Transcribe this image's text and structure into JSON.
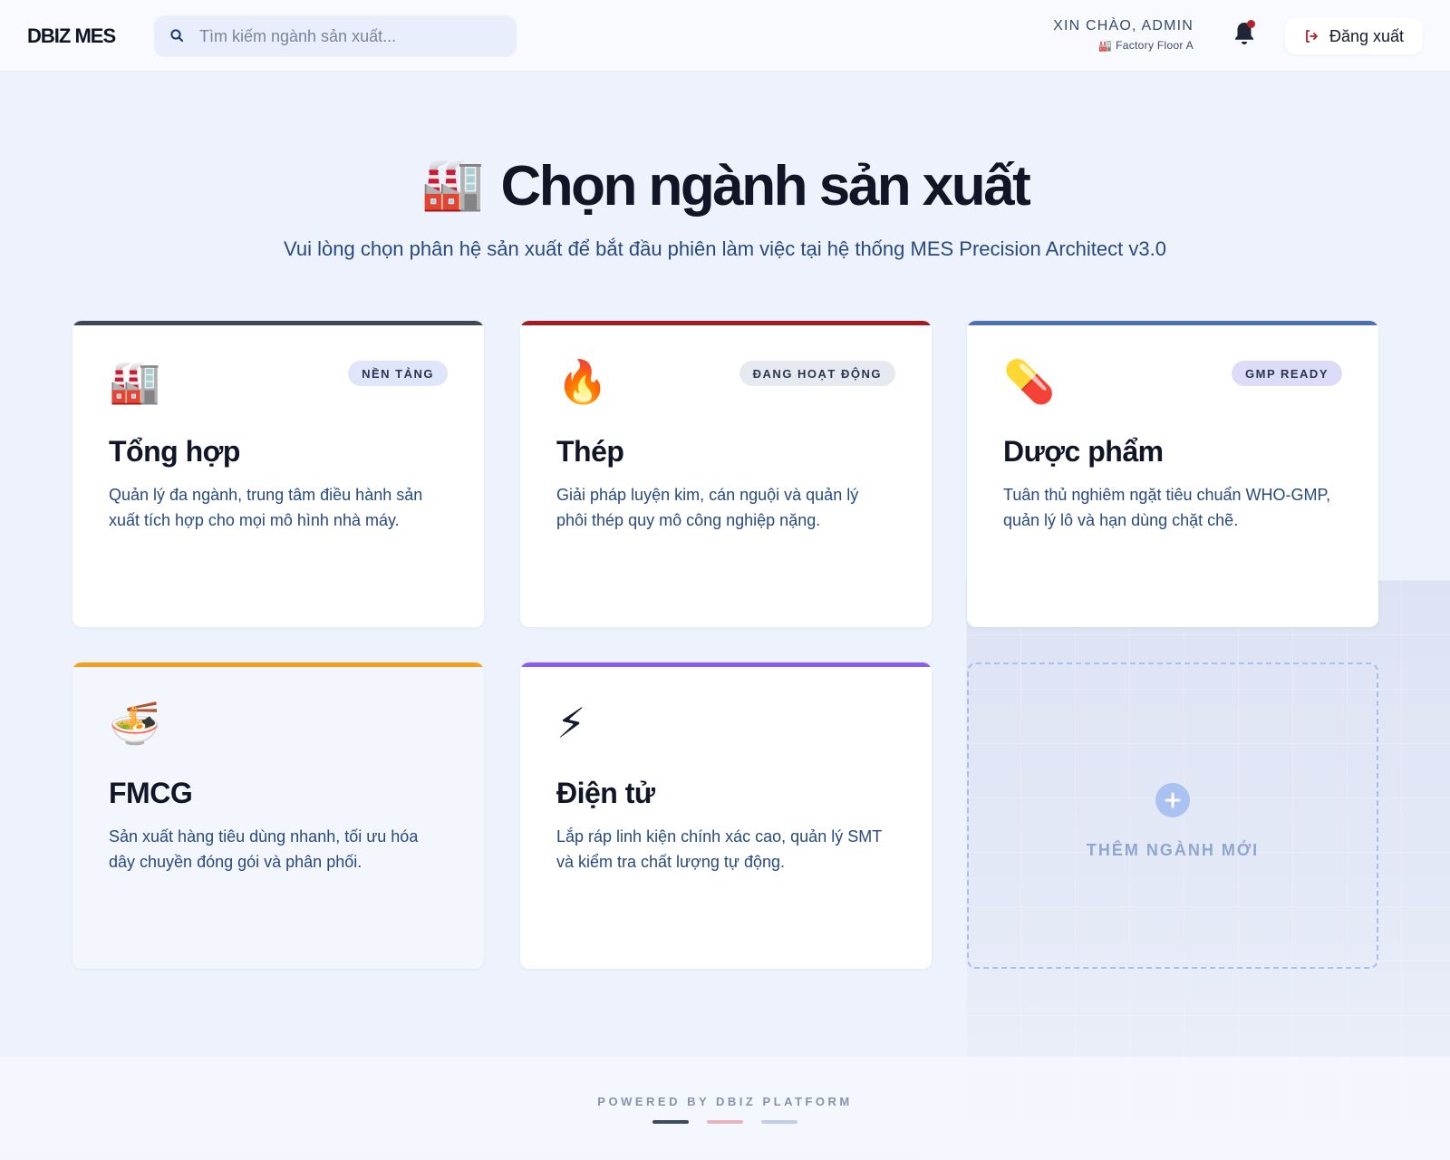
{
  "header": {
    "logo": "DBIZ MES",
    "search_placeholder": "Tìm kiếm ngành sản xuất...",
    "greeting": "XIN CHÀO, ADMIN",
    "location": "🏭 Factory Floor A",
    "logout_label": "Đăng xuất"
  },
  "hero": {
    "icon": "🏭",
    "title": "Chọn ngành sản xuất",
    "subtitle": "Vui lòng chọn phân hệ sản xuất để bắt đầu phiên làm việc tại hệ thống MES Precision Architect v3.0"
  },
  "cards": [
    {
      "icon": "🏭",
      "badge": "NỀN TẢNG",
      "title": "Tổng hợp",
      "description": "Quản lý đa ngành, trung tâm điều hành sản xuất tích hợp cho mọi mô hình nhà máy.",
      "accent": "#3c4758",
      "badge_bg": "#dfe6fb"
    },
    {
      "icon": "🔥",
      "badge": "ĐANG HOẠT ĐỘNG",
      "title": "Thép",
      "description": "Giải pháp luyện kim, cán nguội và quản lý phôi thép quy mô công nghiệp nặng.",
      "accent": "#a11d22",
      "badge_bg": "#e6e9ef"
    },
    {
      "icon": "💊",
      "badge": "GMP READY",
      "title": "Dược phẩm",
      "description": "Tuân thủ nghiêm ngặt tiêu chuẩn WHO-GMP, quản lý lô và hạn dùng chặt chẽ.",
      "accent": "#4a6fb3",
      "badge_bg": "#dcdcf8"
    },
    {
      "icon": "🍜",
      "badge": "",
      "title": "FMCG",
      "description": "Sản xuất hàng tiêu dùng nhanh, tối ưu hóa dây chuyền đóng gói và phân phối.",
      "accent": "#f3a01f"
    },
    {
      "icon": "⚡",
      "badge": "",
      "title": "Điện tử",
      "description": "Lắp ráp linh kiện chính xác cao, quản lý SMT và kiểm tra chất lượng tự động.",
      "accent": "#8a5cf0"
    }
  ],
  "add_card": {
    "label": "THÊM NGÀNH MỚI",
    "icon": "plus-circle-icon"
  },
  "footer": {
    "powered": "POWERED BY DBIZ PLATFORM",
    "indicator_colors": [
      "#3f4a5c",
      "#e6b4bb",
      "#c3cde3"
    ]
  },
  "icons": {
    "search": "search-icon",
    "bell": "bell-icon",
    "logout": "logout-icon"
  },
  "colors": {
    "notification_dot": "#b4232c",
    "subtitle_text": "#274a7e"
  }
}
